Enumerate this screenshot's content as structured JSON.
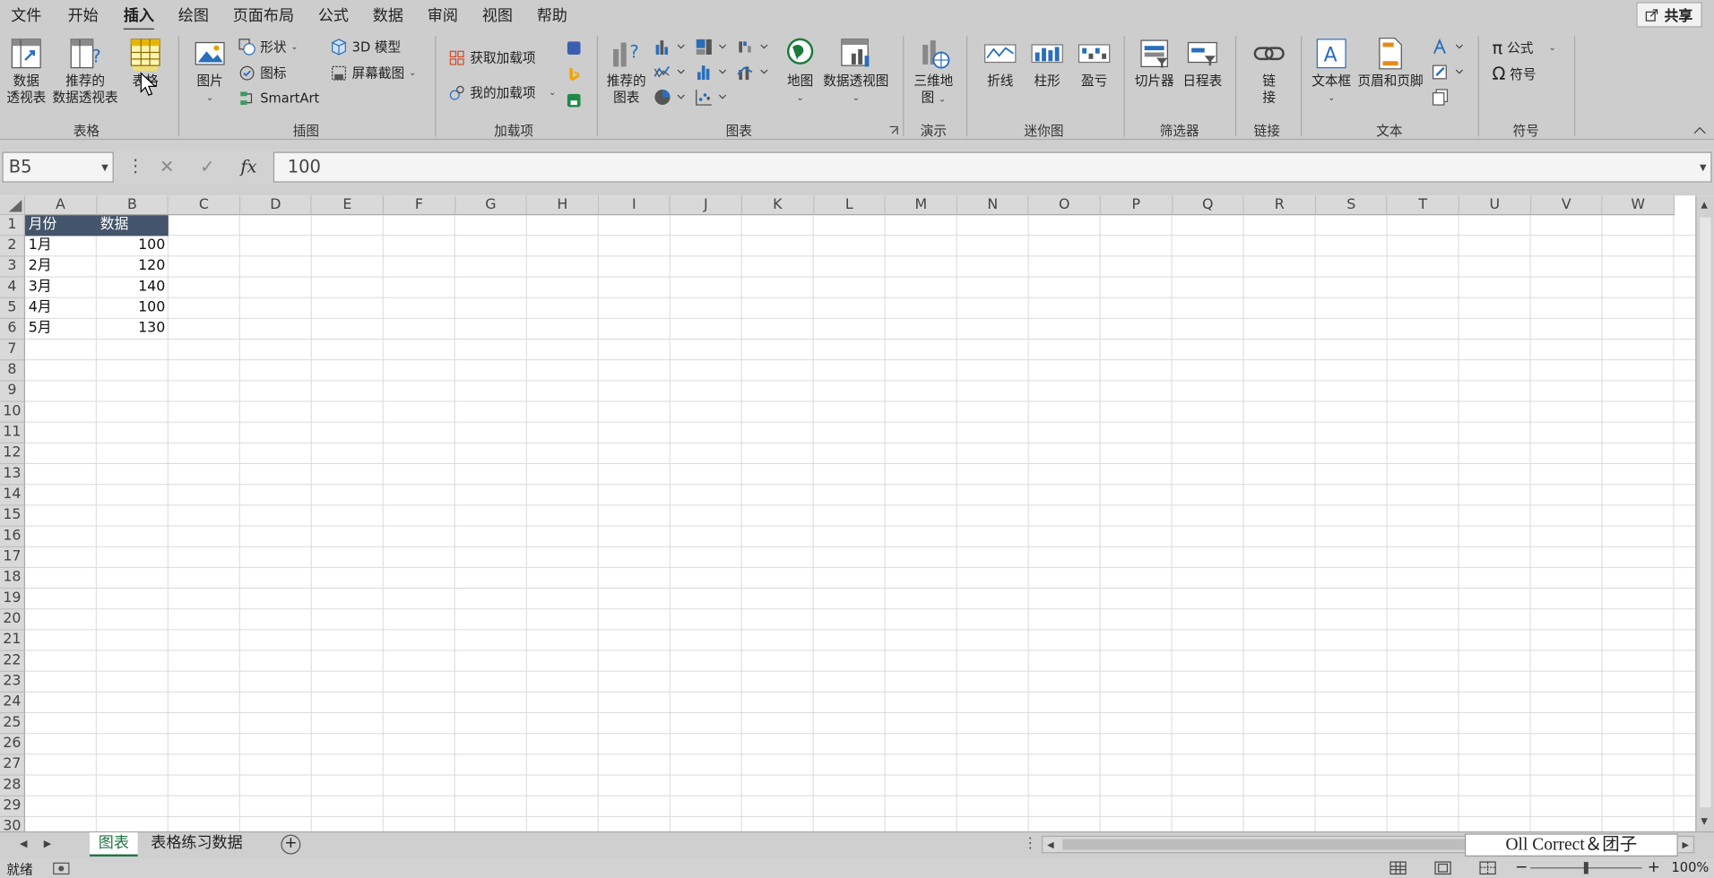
{
  "menu": {
    "items": [
      "文件",
      "开始",
      "插入",
      "绘图",
      "页面布局",
      "公式",
      "数据",
      "审阅",
      "视图",
      "帮助"
    ],
    "active_index": 2,
    "share_label": "共享"
  },
  "ribbon": {
    "groups": {
      "tables": "表格",
      "illustrations": "插图",
      "addins": "加载项",
      "charts": "图表",
      "tours": "演示",
      "sparklines": "迷你图",
      "filters": "筛选器",
      "links": "链接",
      "text": "文本",
      "symbols": "符号"
    },
    "buttons": {
      "pivot_table": [
        "数据",
        "透视表"
      ],
      "recommended_pivot": [
        "推荐的",
        "数据透视表"
      ],
      "table": "表格",
      "pictures": "图片",
      "shapes": "形状",
      "icons": "图标",
      "smartart": "SmartArt",
      "models_3d": "3D 模型",
      "screenshot": "屏幕截图",
      "get_addins": "获取加载项",
      "my_addins": "我的加载项",
      "recommended_charts": [
        "推荐的",
        "图表"
      ],
      "maps": "地图",
      "pivot_chart": "数据透视图",
      "map_3d": [
        "三维地",
        "图"
      ],
      "spark_line": "折线",
      "spark_column": "柱形",
      "spark_winloss": "盈亏",
      "slicer": "切片器",
      "timeline": "日程表",
      "link": [
        "链",
        "接"
      ],
      "textbox": "文本框",
      "header_footer": "页眉和页脚",
      "equation": "公式",
      "symbol": "符号"
    }
  },
  "formula_bar": {
    "name_box": "B5",
    "fx": "fx",
    "value": "100"
  },
  "grid": {
    "columns": [
      "A",
      "B",
      "C",
      "D",
      "E",
      "F",
      "G",
      "H",
      "I",
      "J",
      "K",
      "L",
      "M",
      "N",
      "O",
      "P",
      "Q",
      "R",
      "S",
      "T",
      "U",
      "V",
      "W"
    ],
    "rows": [
      "1",
      "2",
      "3",
      "4",
      "5",
      "6",
      "7",
      "8",
      "9",
      "10",
      "11",
      "12",
      "13",
      "14",
      "15",
      "16",
      "17",
      "18",
      "19",
      "20",
      "21",
      "22",
      "23",
      "24",
      "25",
      "26",
      "27",
      "28",
      "29",
      "30"
    ],
    "header_row": [
      "月份",
      "数据"
    ],
    "data": [
      [
        "1月",
        "100"
      ],
      [
        "2月",
        "120"
      ],
      [
        "3月",
        "140"
      ],
      [
        "4月",
        "100"
      ],
      [
        "5月",
        "130"
      ]
    ]
  },
  "sheets": {
    "tabs": [
      "图表",
      "表格练习数据"
    ],
    "active_index": 0
  },
  "watermark": "Oll Correct＆团子",
  "status": {
    "ready": "就绪",
    "zoom": "100%"
  },
  "colors": {
    "header_fill": "#44546a",
    "accent_green": "#217346"
  }
}
